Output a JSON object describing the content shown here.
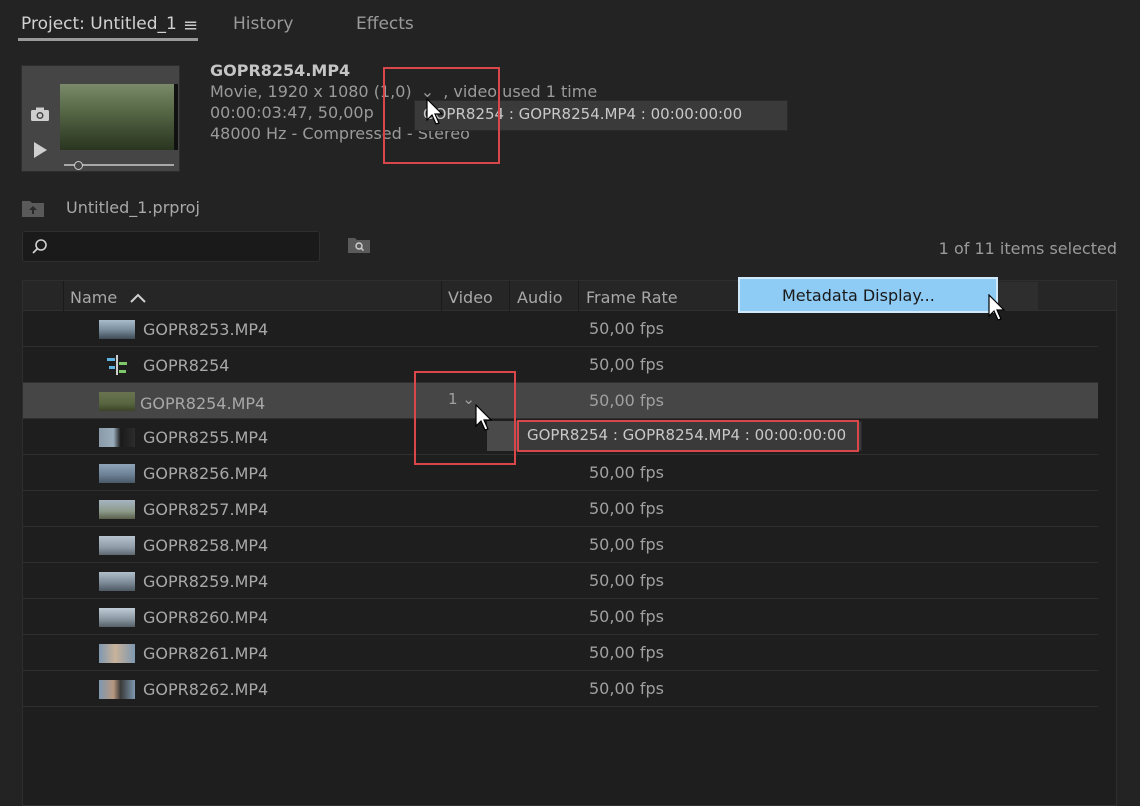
{
  "tabs": [
    {
      "label": "Project: Untitled_1",
      "active": true
    },
    {
      "label": "History",
      "active": false
    },
    {
      "label": "Effects",
      "active": false
    }
  ],
  "clip_info": {
    "filename": "GOPR8254.MP4",
    "line1_prefix": "Movie, 1920 x 1080 (1,0)",
    "line1_suffix": ", video used 1 time",
    "line2": "00:00:03:47, 50,00p",
    "line3": "48000 Hz - Compressed - Stereo"
  },
  "tooltip_top": "GOPR8254 : GOPR8254.MP4 : 00:00:00:00",
  "tooltip_row": "GOPR8254 : GOPR8254.MP4 : 00:00:00:00",
  "bin_path": "Untitled_1.prproj",
  "search": {
    "placeholder": ""
  },
  "selected_count": "1 of 11 items selected",
  "columns": [
    "Name",
    "Video",
    "Audio",
    "Frame Rate"
  ],
  "context_menu": {
    "item": "Metadata Display..."
  },
  "rows": [
    {
      "name": "GOPR8253.MP4",
      "fps": "50,00 fps",
      "video": "",
      "selected": false,
      "type": "clip"
    },
    {
      "name": "GOPR8254",
      "fps": "50,00 fps",
      "video": "",
      "selected": false,
      "type": "sequence"
    },
    {
      "name": "GOPR8254.MP4",
      "fps": "50,00 fps",
      "video": "1",
      "selected": true,
      "type": "clip"
    },
    {
      "name": "GOPR8255.MP4",
      "fps": "",
      "video": "",
      "selected": false,
      "type": "clip"
    },
    {
      "name": "GOPR8256.MP4",
      "fps": "50,00 fps",
      "video": "",
      "selected": false,
      "type": "clip"
    },
    {
      "name": "GOPR8257.MP4",
      "fps": "50,00 fps",
      "video": "",
      "selected": false,
      "type": "clip"
    },
    {
      "name": "GOPR8258.MP4",
      "fps": "50,00 fps",
      "video": "",
      "selected": false,
      "type": "clip"
    },
    {
      "name": "GOPR8259.MP4",
      "fps": "50,00 fps",
      "video": "",
      "selected": false,
      "type": "clip"
    },
    {
      "name": "GOPR8260.MP4",
      "fps": "50,00 fps",
      "video": "",
      "selected": false,
      "type": "clip"
    },
    {
      "name": "GOPR8261.MP4",
      "fps": "50,00 fps",
      "video": "",
      "selected": false,
      "type": "clip"
    },
    {
      "name": "GOPR8262.MP4",
      "fps": "50,00 fps",
      "video": "",
      "selected": false,
      "type": "clip"
    }
  ],
  "colors": {
    "highlight": "#d8474a",
    "menu_bg": "#8ecbf5",
    "selected_row": "#464646"
  }
}
